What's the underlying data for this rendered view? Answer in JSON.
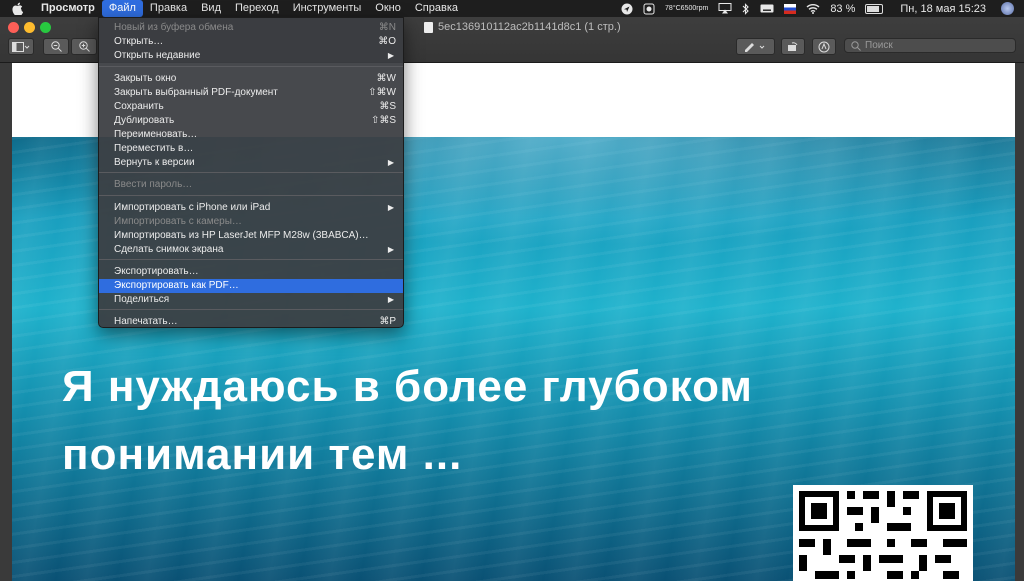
{
  "menubar": {
    "app_name": "Просмотр",
    "items": [
      "Файл",
      "Правка",
      "Вид",
      "Переход",
      "Инструменты",
      "Окно",
      "Справка"
    ],
    "status": {
      "temp_line1": "78°C",
      "temp_line2": "6500rpm",
      "battery": "83 %",
      "datetime": "Пн, 18 мая  15:23"
    }
  },
  "window": {
    "title": "5ec136910112ac2b1141d8c1 (1 стр.)",
    "search_placeholder": "Поиск"
  },
  "file_menu": {
    "items": [
      {
        "label": "Новый из буфера обмена",
        "shortcut": "⌘N",
        "disabled": true
      },
      {
        "label": "Открыть…",
        "shortcut": "⌘O"
      },
      {
        "label": "Открыть недавние",
        "shortcut": "▶"
      },
      {
        "label": "Закрыть окно",
        "shortcut": "⌘W"
      },
      {
        "label": "Закрыть выбранный PDF-документ",
        "shortcut": "⇧⌘W"
      },
      {
        "label": "Сохранить",
        "shortcut": "⌘S"
      },
      {
        "label": "Дублировать",
        "shortcut": "⇧⌘S"
      },
      {
        "label": "Переименовать…",
        "shortcut": ""
      },
      {
        "label": "Переместить в…",
        "shortcut": ""
      },
      {
        "label": "Вернуть к версии",
        "shortcut": "▶"
      },
      {
        "label": "Ввести пароль…",
        "shortcut": "",
        "disabled": true
      },
      {
        "label": "Импортировать с iPhone или iPad",
        "shortcut": "▶"
      },
      {
        "label": "Импортировать с камеры…",
        "shortcut": "",
        "disabled": true
      },
      {
        "label": "Импортировать из HP LaserJet MFP M28w (3BABCA)…",
        "shortcut": ""
      },
      {
        "label": "Сделать снимок экрана",
        "shortcut": "▶"
      },
      {
        "label": "Экспортировать…",
        "shortcut": ""
      },
      {
        "label": "Экспортировать как PDF…",
        "shortcut": "",
        "highlighted": true
      },
      {
        "label": "Поделиться",
        "shortcut": "▶"
      },
      {
        "label": "Напечатать…",
        "shortcut": "⌘P"
      }
    ]
  },
  "document": {
    "line1": "Я нуждаюсь в более глубоком",
    "line2": "понимании тем ..."
  },
  "colors": {
    "menu_highlight": "#2f6ddf",
    "close": "#fe5f57",
    "minimize": "#febc2e",
    "maximize": "#28c840"
  }
}
